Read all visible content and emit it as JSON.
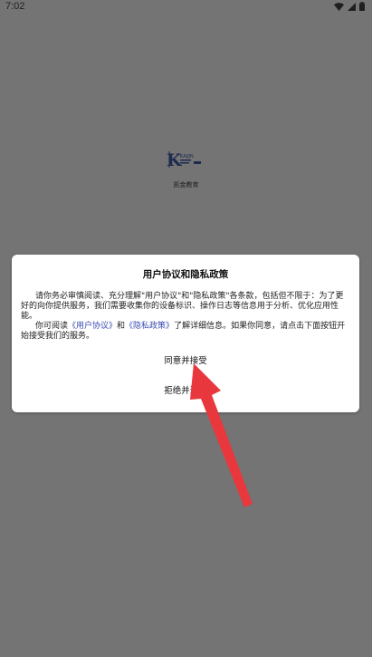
{
  "status_bar": {
    "time": "7:02"
  },
  "splash": {
    "logo_text": "K",
    "logo_brand": "KAIJIN",
    "label": "凯金教育"
  },
  "dialog": {
    "title": "用户协议和隐私政策",
    "paragraph1": "请你务必审慎阅读、充分理解\"用户协议\"和\"隐私政策\"各条款，包括但不限于：为了更好的向你提供服务，我们需要收集你的设备标识、操作日志等信息用于分析、优化应用性能。",
    "paragraph2_prefix": "你可阅读",
    "link_user_agreement": "《用户协议》",
    "paragraph2_and": "和",
    "link_privacy_policy": "《隐私政策》",
    "paragraph2_suffix": "了解详细信息。如果你同意，请点击下面按钮开始接受我们的服务。",
    "agree_label": "同意并接受",
    "reject_label": "拒绝并退出"
  },
  "colors": {
    "overlay": "#747474",
    "dialog_bg": "#ffffff",
    "link": "#3a4bb0",
    "annotation_arrow": "#e8383d"
  }
}
